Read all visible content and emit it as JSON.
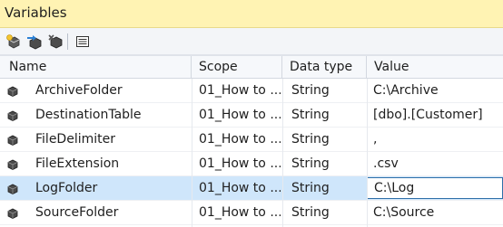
{
  "window": {
    "title": "Variables"
  },
  "toolbar": {
    "buttons": [
      {
        "name": "add-variable",
        "icon": "add-variable-icon"
      },
      {
        "name": "move-variable",
        "icon": "move-variable-icon"
      },
      {
        "name": "delete-variable",
        "icon": "delete-variable-icon"
      },
      {
        "name": "grid-options",
        "icon": "grid-options-icon"
      }
    ]
  },
  "grid": {
    "columns": {
      "name": "Name",
      "scope": "Scope",
      "datatype": "Data type",
      "value": "Value"
    },
    "rows": [
      {
        "name": "ArchiveFolder",
        "scope": "01_How to ...",
        "datatype": "String",
        "value": "C:\\Archive"
      },
      {
        "name": "DestinationTable",
        "scope": "01_How to ...",
        "datatype": "String",
        "value": "[dbo].[Customer]"
      },
      {
        "name": "FileDelimiter",
        "scope": "01_How to ...",
        "datatype": "String",
        "value": ","
      },
      {
        "name": "FileExtension",
        "scope": "01_How to ...",
        "datatype": "String",
        "value": ".csv"
      },
      {
        "name": "LogFolder",
        "scope": "01_How to ...",
        "datatype": "String",
        "value": "C:\\Log"
      },
      {
        "name": "SourceFolder",
        "scope": "01_How to ...",
        "datatype": "String",
        "value": "C:\\Source"
      }
    ],
    "selected_row": 4
  },
  "colors": {
    "titlebar": "#fff3b3",
    "selection": "#cfe6fb",
    "edit_border": "#2f6fa8"
  }
}
